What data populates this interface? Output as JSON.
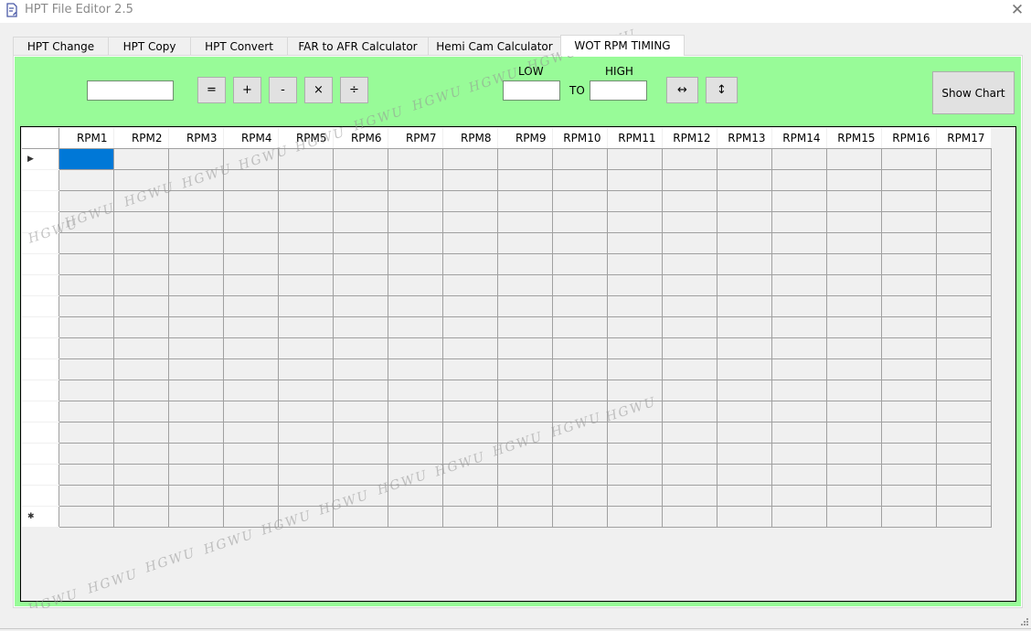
{
  "window": {
    "title": "HPT File Editor 2.5",
    "close_label": "✕"
  },
  "tabs": [
    {
      "label": "HPT Change",
      "selected": false
    },
    {
      "label": "HPT Copy",
      "selected": false
    },
    {
      "label": "HPT Convert",
      "selected": false
    },
    {
      "label": "FAR to AFR Calculator",
      "selected": false
    },
    {
      "label": "Hemi Cam Calculator",
      "selected": false
    },
    {
      "label": "WOT RPM TIMING",
      "selected": true
    }
  ],
  "toolbar": {
    "value_input": {
      "value": "",
      "placeholder": ""
    },
    "op_buttons": [
      "=",
      "+",
      "-",
      "×",
      "÷"
    ],
    "low_label": "LOW",
    "high_label": "HIGH",
    "to_label": "TO",
    "low_input": {
      "value": ""
    },
    "high_input": {
      "value": ""
    },
    "interpolate_horizontal_label": "↔",
    "interpolate_vertical_label": "↕",
    "show_chart_label": "Show Chart"
  },
  "grid": {
    "columns": [
      "RPM1",
      "RPM2",
      "RPM3",
      "RPM4",
      "RPM5",
      "RPM6",
      "RPM7",
      "RPM8",
      "RPM9",
      "RPM10",
      "RPM11",
      "RPM12",
      "RPM13",
      "RPM14",
      "RPM15",
      "RPM16",
      "RPM17"
    ],
    "row_count": 17,
    "current_row_indicator": "▶",
    "new_row_indicator": "✱",
    "selected_cell": {
      "row": 1,
      "column": "RPM1"
    },
    "selection_color": "#0078d7"
  },
  "colors": {
    "panel_background": "#98fb98",
    "grid_background": "#f0f0f0"
  },
  "watermark_text": "HGWU"
}
